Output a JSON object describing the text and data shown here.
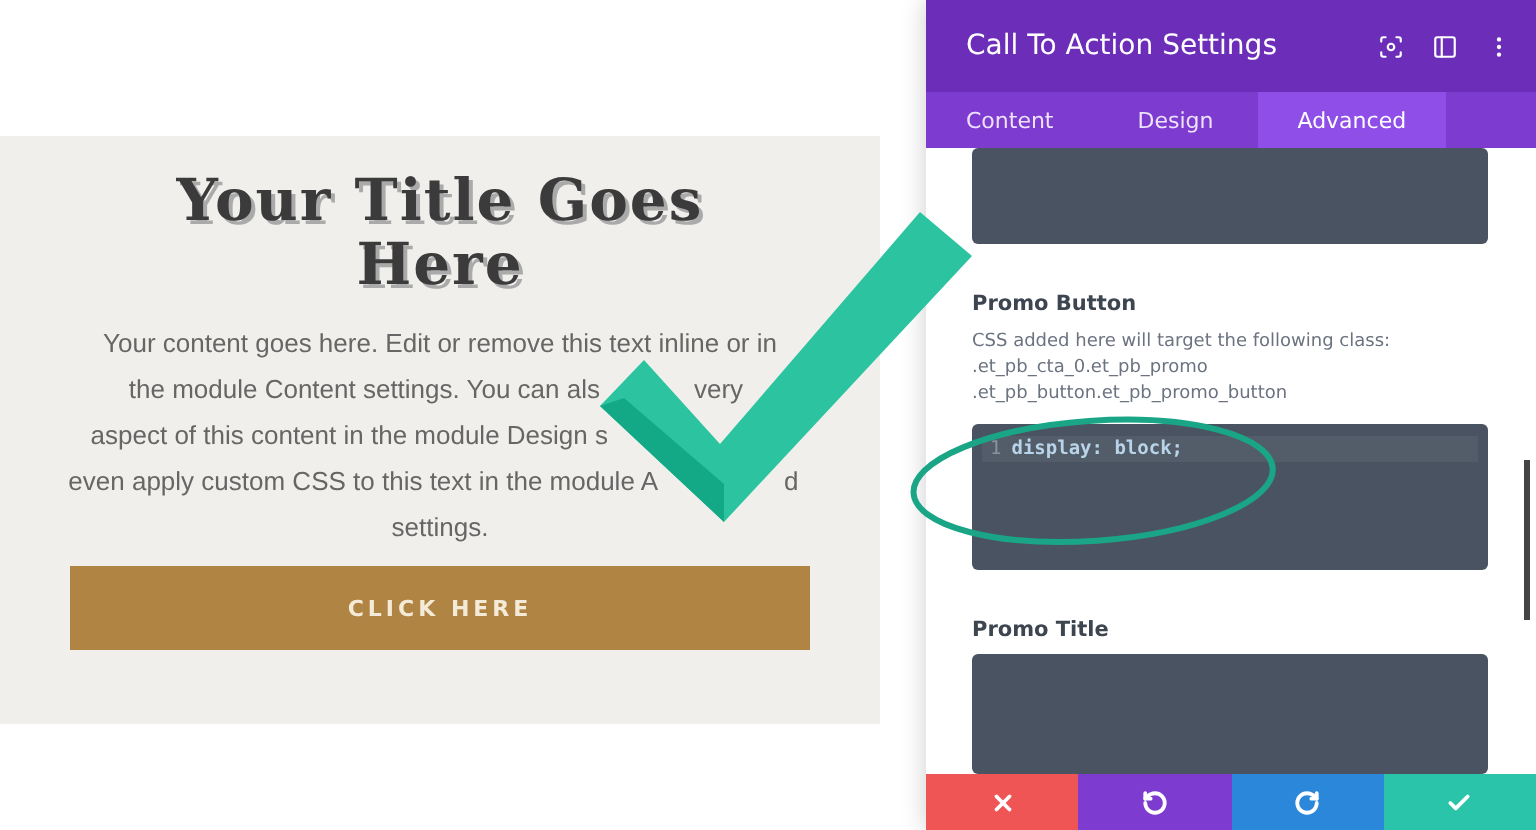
{
  "page": {
    "title": "Your Title Goes Here",
    "body_lines": [
      [
        "Your content goes here. Edit or remove this text inline or in"
      ],
      [
        "the module Content settings. You can als",
        "very"
      ],
      [
        "aspect of this content in the module Design s"
      ],
      [
        "even apply custom CSS to this text in the module A",
        "d"
      ],
      [
        "settings."
      ]
    ],
    "button": "CLICK HERE"
  },
  "settings": {
    "title": "Call To Action Settings",
    "tabs": [
      {
        "label": "Content",
        "selected": false
      },
      {
        "label": "Design",
        "selected": false
      },
      {
        "label": "Advanced",
        "selected": true
      }
    ],
    "sections": [
      {
        "kind": "editor"
      },
      {
        "kind": "css",
        "label": "Promo Button",
        "help": "CSS added here will target the following class:",
        "selectors": [
          ".et_pb_cta_0.et_pb_promo",
          ".et_pb_button.et_pb_promo_button"
        ],
        "code_lines": [
          {
            "number": "1",
            "code": "display: block;"
          }
        ]
      },
      {
        "kind": "css",
        "label": "Promo Title"
      }
    ],
    "footer": [
      {
        "kind": "discard"
      },
      {
        "kind": "undo"
      },
      {
        "kind": "redo"
      },
      {
        "kind": "save"
      }
    ]
  }
}
